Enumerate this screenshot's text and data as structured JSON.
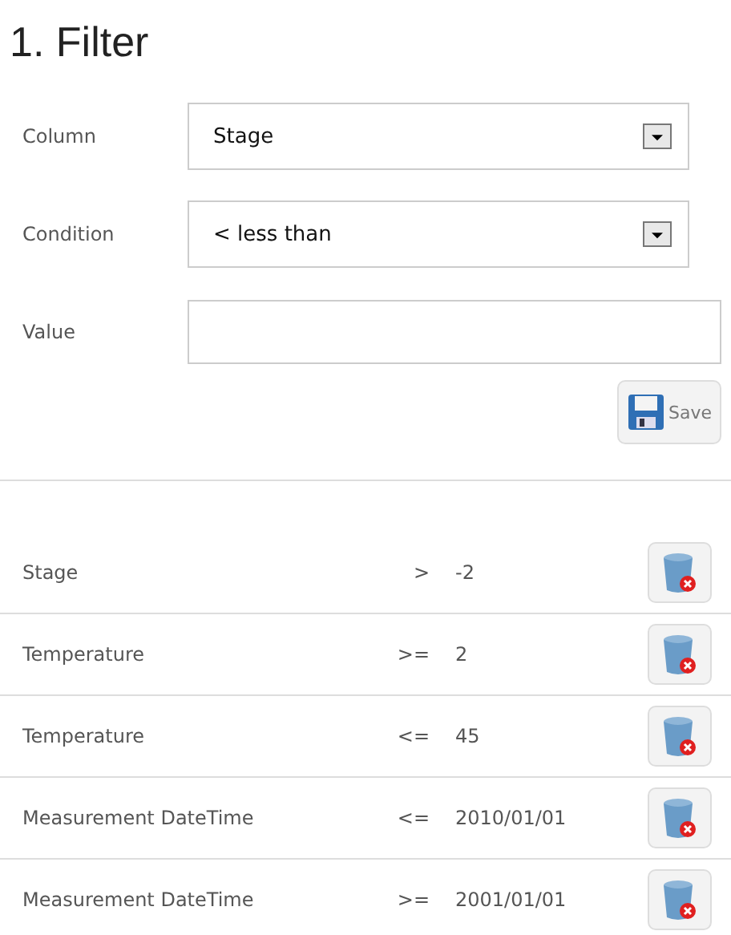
{
  "title": "1. Filter",
  "form": {
    "column": {
      "label": "Column",
      "value": "Stage"
    },
    "condition": {
      "label": "Condition",
      "value": "< less than"
    },
    "value": {
      "label": "Value"
    },
    "save_button": "Save"
  },
  "filters": [
    {
      "column": "Stage",
      "operator": ">",
      "value": "-2"
    },
    {
      "column": "Temperature",
      "operator": ">=",
      "value": "2"
    },
    {
      "column": "Temperature",
      "operator": "<=",
      "value": "45"
    },
    {
      "column": "Measurement DateTime",
      "operator": "<=",
      "value": "2010/01/01"
    },
    {
      "column": "Measurement DateTime",
      "operator": ">=",
      "value": "2001/01/01"
    }
  ]
}
